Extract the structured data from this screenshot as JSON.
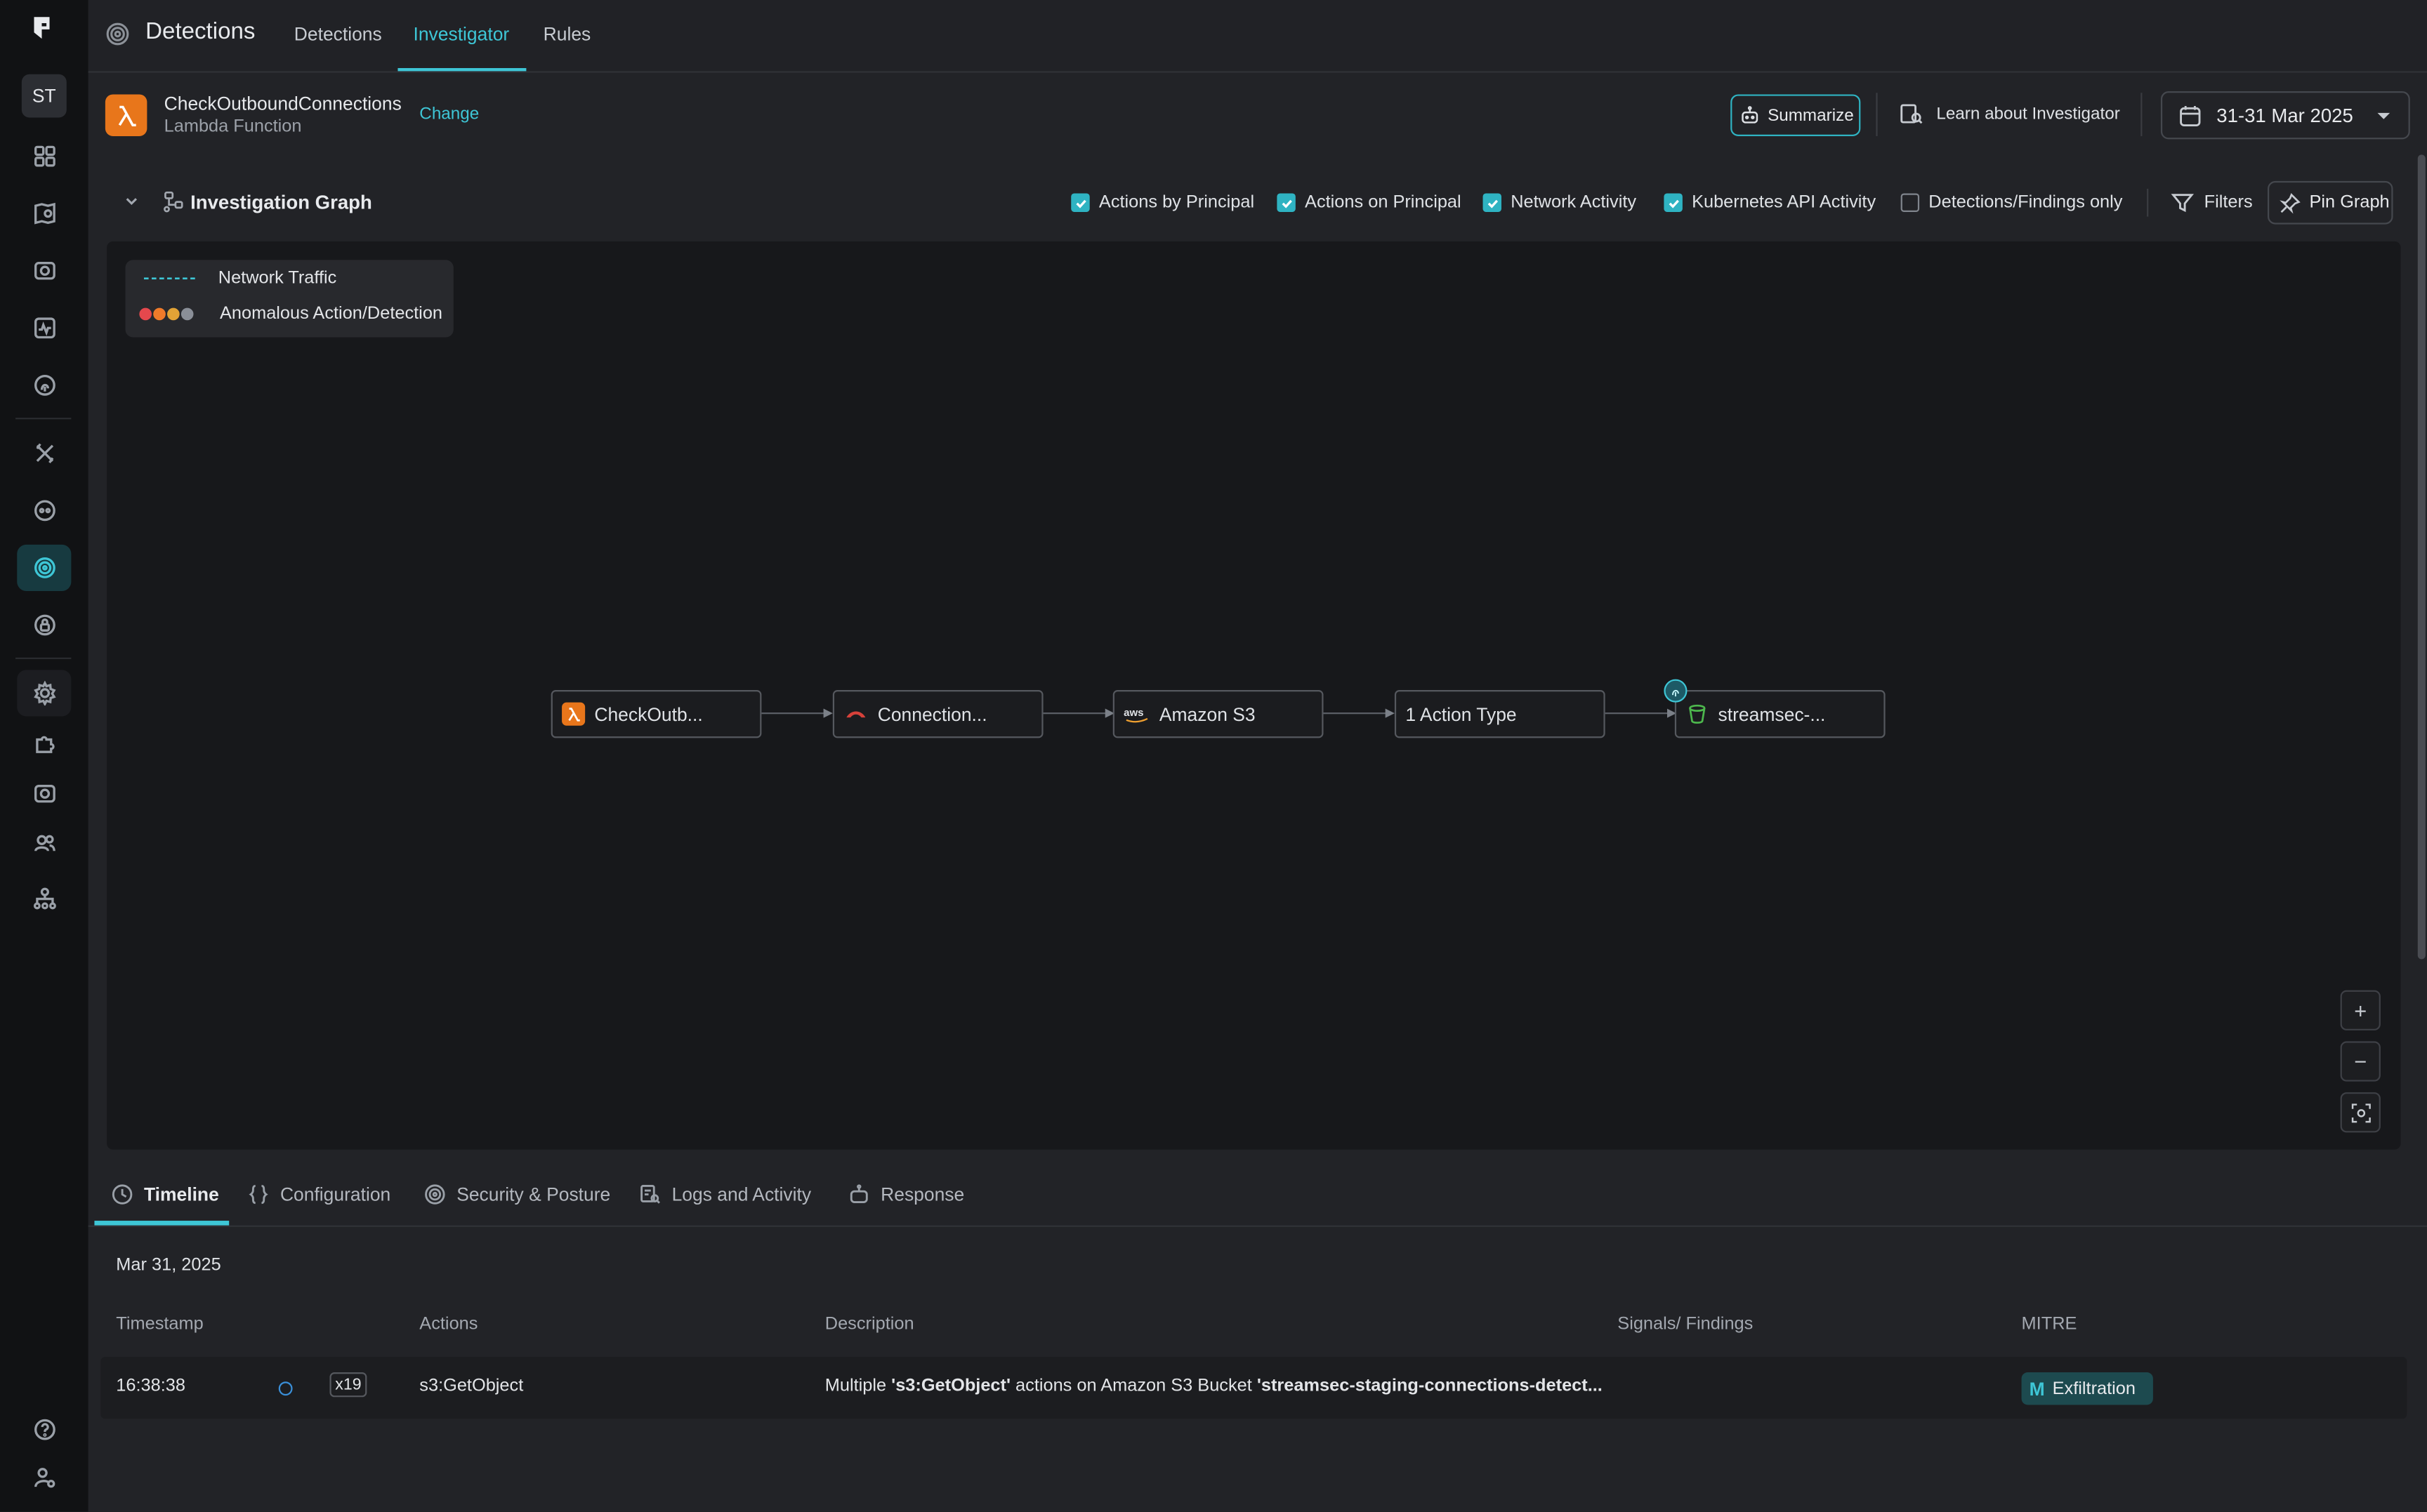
{
  "sidebar": {
    "avatar": "ST",
    "items": [
      {
        "icon": "dashboard-icon"
      },
      {
        "icon": "inventory-map-icon"
      },
      {
        "icon": "camera-icon"
      },
      {
        "icon": "activity-icon"
      },
      {
        "icon": "fingerprint-icon"
      },
      {
        "icon": "tools-icon"
      },
      {
        "icon": "bot-icon"
      },
      {
        "icon": "detections-target-icon",
        "active": true
      },
      {
        "icon": "lock-icon"
      },
      {
        "icon": "gear-icon"
      },
      {
        "icon": "puzzle-icon"
      },
      {
        "icon": "camera-settings-icon"
      },
      {
        "icon": "users-icon"
      },
      {
        "icon": "org-tree-icon"
      }
    ],
    "bottom": [
      {
        "icon": "help-icon"
      },
      {
        "icon": "user-settings-icon"
      }
    ]
  },
  "topbar": {
    "title": "Detections",
    "tabs": [
      {
        "label": "Detections"
      },
      {
        "label": "Investigator",
        "active": true
      },
      {
        "label": "Rules"
      }
    ]
  },
  "resource": {
    "name": "CheckOutboundConnections",
    "type": "Lambda Function",
    "change_label": "Change"
  },
  "header_actions": {
    "summarize": "Summarize",
    "learn": "Learn about Investigator",
    "date_range": "31-31 Mar 2025"
  },
  "graph": {
    "title": "Investigation Graph",
    "filters": [
      {
        "label": "Actions by Principal",
        "checked": true
      },
      {
        "label": "Actions on Principal",
        "checked": true
      },
      {
        "label": "Network Activity",
        "checked": true
      },
      {
        "label": "Kubernetes API Activity",
        "checked": true
      },
      {
        "label": "Detections/Findings only",
        "checked": false
      }
    ],
    "filters_label": "Filters",
    "pin_label": "Pin Graph",
    "legend": {
      "network_traffic": "Network Traffic",
      "anomalous": "Anomalous Action/Detection",
      "severity_colors": [
        "#e5484d",
        "#f07b2a",
        "#e2a336",
        "#8a8f98"
      ]
    },
    "nodes": [
      {
        "label": "CheckOutb...",
        "icon": "lambda-icon"
      },
      {
        "label": "Connection...",
        "icon": "redis-icon"
      },
      {
        "label": "Amazon S3",
        "icon": "aws-icon"
      },
      {
        "label": "1 Action Type",
        "icon": ""
      },
      {
        "label": "streamsec-...",
        "icon": "s3-bucket-icon"
      }
    ],
    "zoom": {
      "in": "+",
      "out": "−"
    }
  },
  "bottom_tabs": [
    {
      "label": "Timeline",
      "active": true
    },
    {
      "label": "Configuration"
    },
    {
      "label": "Security & Posture"
    },
    {
      "label": "Logs and Activity"
    },
    {
      "label": "Response"
    }
  ],
  "timeline": {
    "date": "Mar 31, 2025",
    "columns": [
      "Timestamp",
      "Actions",
      "Description",
      "Signals/ Findings",
      "MITRE"
    ],
    "rows": [
      {
        "timestamp": "16:38:38",
        "count": "x19",
        "action": "s3:GetObject",
        "desc_prefix": "Multiple ",
        "desc_action": "'s3:GetObject'",
        "desc_mid": " actions on Amazon S3 Bucket ",
        "desc_bucket": "'streamsec-staging-connections-detect...",
        "mitre_letter": "M",
        "mitre": "Exfiltration"
      }
    ]
  }
}
